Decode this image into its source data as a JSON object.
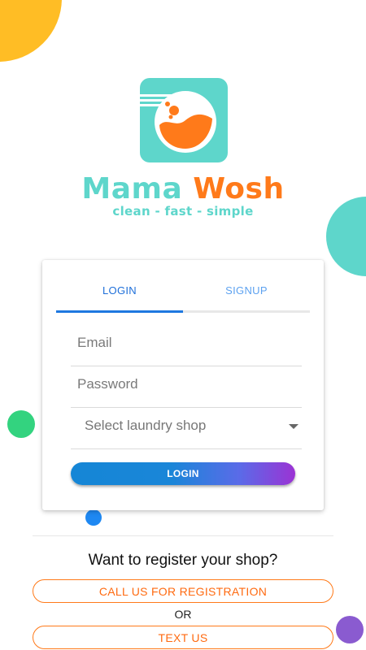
{
  "brand": {
    "name_part1": "Mama",
    "name_part2": "Wosh",
    "tagline": "clean - fast - simple",
    "colors": {
      "teal": "#5ED6CB",
      "orange": "#FF7A1A"
    }
  },
  "auth": {
    "tabs": [
      {
        "label": "LOGIN",
        "active": true
      },
      {
        "label": "SIGNUP",
        "active": false
      }
    ],
    "email_placeholder": "Email",
    "password_placeholder": "Password",
    "shop_select": {
      "value": "Select laundry shop",
      "icon": "chevron-down-icon"
    },
    "login_button": "LOGIN"
  },
  "register": {
    "question": "Want to register your shop?",
    "call_button": "CALL US FOR REGISTRATION",
    "or_label": "OR",
    "text_button": "TEXT US"
  }
}
